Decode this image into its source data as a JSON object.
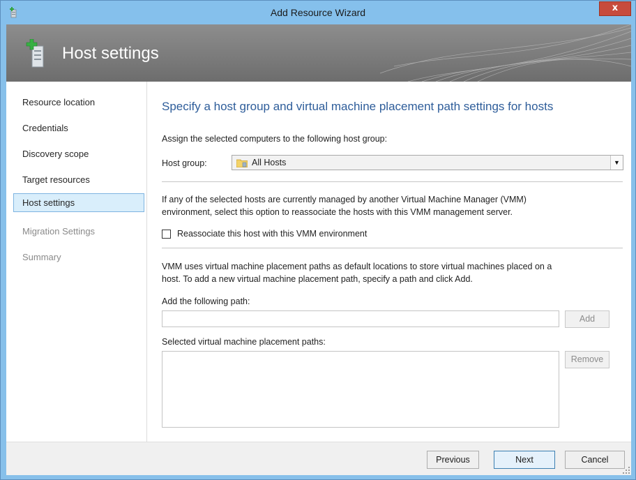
{
  "window": {
    "title": "Add Resource Wizard",
    "close_label": "x"
  },
  "header": {
    "heading": "Host settings"
  },
  "sidebar": {
    "items": [
      {
        "label": "Resource location",
        "state": "normal"
      },
      {
        "label": "Credentials",
        "state": "normal"
      },
      {
        "label": "Discovery scope",
        "state": "normal"
      },
      {
        "label": "Target resources",
        "state": "normal"
      },
      {
        "label": "Host settings",
        "state": "active"
      },
      {
        "label": "Migration Settings",
        "state": "disabled"
      },
      {
        "label": "Summary",
        "state": "disabled"
      }
    ]
  },
  "main": {
    "title": "Specify a host group and virtual machine placement path settings for hosts",
    "assign_text": "Assign the selected computers to the following host group:",
    "host_group_label": "Host group:",
    "host_group_value": "All Hosts",
    "reassociate_text_1": "If any of the selected hosts are currently managed by another Virtual Machine Manager (VMM)",
    "reassociate_text_2": "environment, select this option to reassociate the hosts with this VMM management server.",
    "reassociate_checkbox_label": "Reassociate this host with this VMM environment",
    "reassociate_checked": false,
    "paths_text_1": "VMM uses virtual machine placement paths as default locations to store virtual machines placed on a",
    "paths_text_2": "host. To add a new virtual machine placement path, specify a path and click Add.",
    "add_path_label": "Add the following path:",
    "add_path_value": "",
    "add_button": "Add",
    "selected_paths_label": "Selected virtual machine placement paths:",
    "selected_paths": [],
    "remove_button": "Remove"
  },
  "footer": {
    "previous": "Previous",
    "next": "Next",
    "cancel": "Cancel"
  },
  "colors": {
    "titlebar": "#85c0ec",
    "close": "#c74b3c",
    "banner": "#7a7a7a",
    "page_title": "#2e5d9a",
    "active_item": "#d9eefb"
  }
}
